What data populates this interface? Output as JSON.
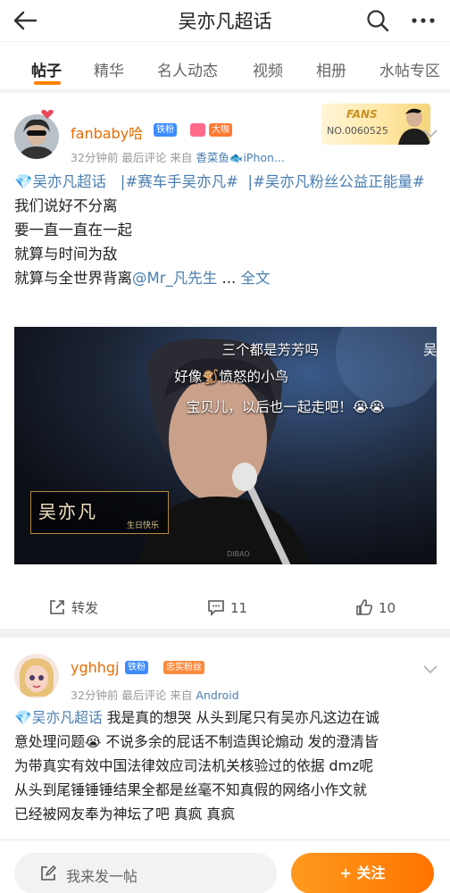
{
  "header": {
    "title": "吴亦凡超话"
  },
  "tabs": [
    {
      "label": "帖子"
    },
    {
      "label": "精华"
    },
    {
      "label": "名人动态"
    },
    {
      "label": "视频"
    },
    {
      "label": "相册"
    },
    {
      "label": "水帖专区"
    }
  ],
  "posts": [
    {
      "username": "fanbaby哈",
      "badges": [
        "铁粉",
        "大咖"
      ],
      "time": "32分钟前",
      "last_comment": "最后评论",
      "from_label": "来自",
      "source": "香菜鱼🐟iPhon...",
      "fans_banner": {
        "word": "FANS",
        "number": "NO.0060525"
      },
      "text_topics": [
        "吴亦凡超话",
        "#赛车手吴亦凡#",
        "#吴亦凡粉丝公益正能量#"
      ],
      "lines": [
        "我们说好不分离",
        "要一直一直在一起",
        "就算与时间为敌"
      ],
      "last_line": "就算与全世界背离",
      "mention": "@Mr_凡先生",
      "ellipsis": " ... ",
      "full_text": "全文",
      "video": {
        "captions": [
          "三个都是芳芳吗",
          "好像🐒愤怒的小鸟",
          "宝贝儿，以后也一起走吧！😭😭"
        ],
        "cut_text": "吴",
        "name_title": "吴亦凡",
        "name_sub": "生日快乐",
        "watermark": "DIBAO"
      },
      "repost_label": "转发",
      "comments": "11",
      "likes": "10"
    },
    {
      "username": "yghhgj",
      "badges": [
        "铁粉",
        "忠实粉丝"
      ],
      "time": "32分钟前",
      "last_comment": "最后评论",
      "from_label": "来自",
      "source": "Android",
      "topic": "吴亦凡超话",
      "lines": [
        "我是真的想哭 从头到尾只有吴亦凡这边在诚",
        "意处理问题😭 不说多余的屁话不制造舆论煽动 发的澄清皆",
        "为带真实有效中国法律效应司法机关核验过的依据 dmz呢",
        "从头到尾锤锤锤结果全都是丝毫不知真假的网络小作文就",
        "已经被网友奉为神坛了吧  真疯 真疯"
      ]
    }
  ],
  "bottom": {
    "compose_placeholder": "我来发一帖",
    "follow_label": "+ 关注"
  },
  "colors": {
    "accent": "#ff8200",
    "link": "#4a7eb0",
    "username": "#e86b00"
  }
}
